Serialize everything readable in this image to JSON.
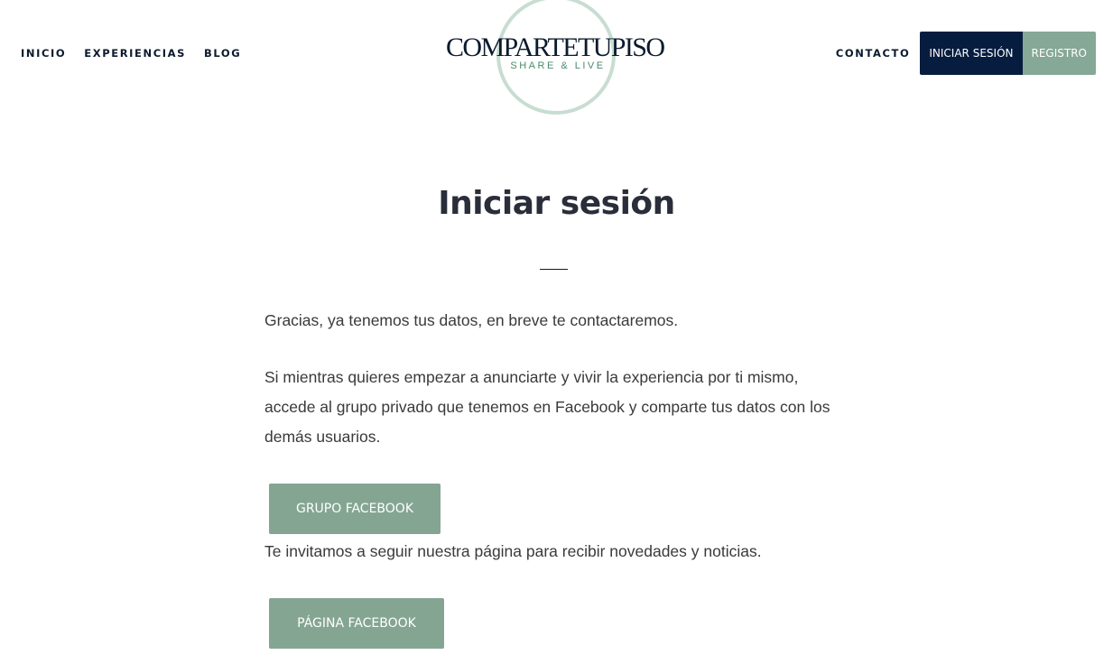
{
  "header": {
    "nav_left": [
      {
        "label": "INICIO"
      },
      {
        "label": "EXPERIENCIAS"
      },
      {
        "label": "BLOG"
      }
    ],
    "logo": {
      "name": "COMPARTETUPISO",
      "tagline": "SHARE & LIVE",
      "circle_color": "#c8ddd2"
    },
    "contact_label": "CONTACTO",
    "login_label": "INICIAR SESIÓN",
    "register_label": "REGISTRO"
  },
  "main": {
    "title": "Iniciar sesión",
    "paragraph_1": "Gracias, ya tenemos tus datos, en breve te contactaremos.",
    "paragraph_2": "Si mientras quieres empezar a anunciarte y vivir la experiencia por ti mismo, accede al grupo privado que tenemos en Facebook y comparte tus datos con los demás usuarios.",
    "group_button": "GRUPO FACEBOOK",
    "paragraph_3": "Te invitamos a seguir nuestra página para recibir novedades y noticias.",
    "page_button": "PÁGINA FACEBOOK"
  },
  "colors": {
    "navy": "#061d3f",
    "sage": "#86a896",
    "title": "#2a2e3a"
  }
}
